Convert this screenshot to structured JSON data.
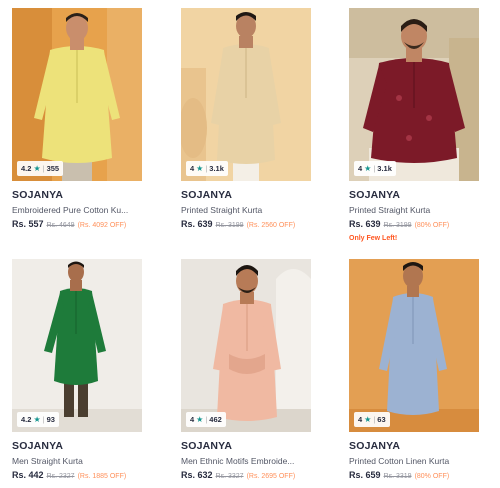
{
  "products": [
    {
      "rating": "4.2",
      "reviews": "355",
      "brand": "SOJANYA",
      "title": "Embroidered Pure Cotton Ku...",
      "price": "Rs. 557",
      "mrp": "Rs. 4649",
      "discount": "(Rs. 4092 OFF)",
      "stock_note": "",
      "bg": "#e7a24c",
      "kurta": "#ede27a"
    },
    {
      "rating": "4",
      "reviews": "3.1k",
      "brand": "SOJANYA",
      "title": "Printed Straight Kurta",
      "price": "Rs. 639",
      "mrp": "Rs. 3199",
      "discount": "(Rs. 2560 OFF)",
      "stock_note": "",
      "bg": "#f1d4a3",
      "kurta": "#e8d2a6"
    },
    {
      "rating": "4",
      "reviews": "3.1k",
      "brand": "SOJANYA",
      "title": "Printed Straight Kurta",
      "price": "Rs. 639",
      "mrp": "Rs. 3199",
      "discount": "(80% OFF)",
      "stock_note": "Only Few Left!",
      "bg": "#ddd0b8",
      "kurta": "#7c1a28"
    },
    {
      "rating": "4.2",
      "reviews": "93",
      "brand": "SOJANYA",
      "title": "Men Straight Kurta",
      "price": "Rs. 442",
      "mrp": "Rs. 2327",
      "discount": "(Rs. 1885 OFF)",
      "stock_note": "",
      "bg": "#f0ede8",
      "kurta": "#1e7b3a"
    },
    {
      "rating": "4",
      "reviews": "462",
      "brand": "SOJANYA",
      "title": "Men Ethnic Motifs Embroide...",
      "price": "Rs. 632",
      "mrp": "Rs. 3327",
      "discount": "(Rs. 2695 OFF)",
      "stock_note": "",
      "bg": "#e9e5df",
      "kurta": "#f0b9a2"
    },
    {
      "rating": "4",
      "reviews": "63",
      "brand": "SOJANYA",
      "title": "Printed Cotton Linen Kurta",
      "price": "Rs. 659",
      "mrp": "Rs. 3319",
      "discount": "(80% OFF)",
      "stock_note": "",
      "bg": "#e09a4d",
      "kurta": "#9cb2d2"
    }
  ],
  "icons": {
    "rating_star": "star-icon"
  }
}
